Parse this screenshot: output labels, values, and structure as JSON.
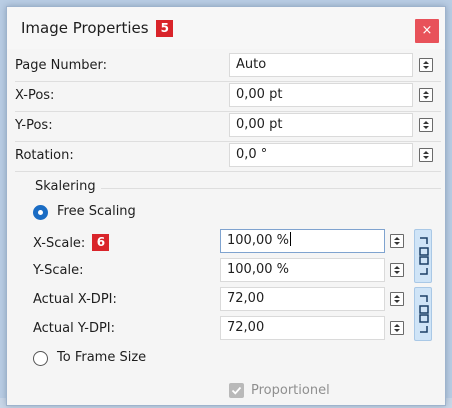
{
  "dialog": {
    "title": "Image Properties",
    "title_marker": "5",
    "close_label": "×"
  },
  "rows": [
    {
      "label": "Page Number:",
      "value": "Auto"
    },
    {
      "label": "X-Pos:",
      "value": "0,00 pt"
    },
    {
      "label": "Y-Pos:",
      "value": "0,00 pt"
    },
    {
      "label": "Rotation:",
      "value": "0,0 °"
    }
  ],
  "scaling": {
    "group_label": "Skalering",
    "free_scaling_label": "Free Scaling",
    "free_scaling_selected": true,
    "x_scale": {
      "label": "X-Scale:",
      "marker": "6",
      "value": "100,00 %"
    },
    "y_scale": {
      "label": "Y-Scale:",
      "value": "100,00 %"
    },
    "x_dpi": {
      "label": "Actual X-DPI:",
      "value": "72,00"
    },
    "y_dpi": {
      "label": "Actual Y-DPI:",
      "value": "72,00"
    },
    "to_frame_label": "To Frame Size",
    "to_frame_selected": false,
    "proportional_label": "Proportionel",
    "proportional_checked": true,
    "proportional_enabled": false
  },
  "colors": {
    "accent": "#1a6cc4",
    "marker": "#d9242a",
    "close": "#e8525a",
    "chain_bg": "#cfe4f7"
  },
  "icons": {
    "close": "close-icon",
    "spinner": "spinner-icon",
    "chain": "chain-link-icon",
    "check": "checkmark-icon"
  }
}
